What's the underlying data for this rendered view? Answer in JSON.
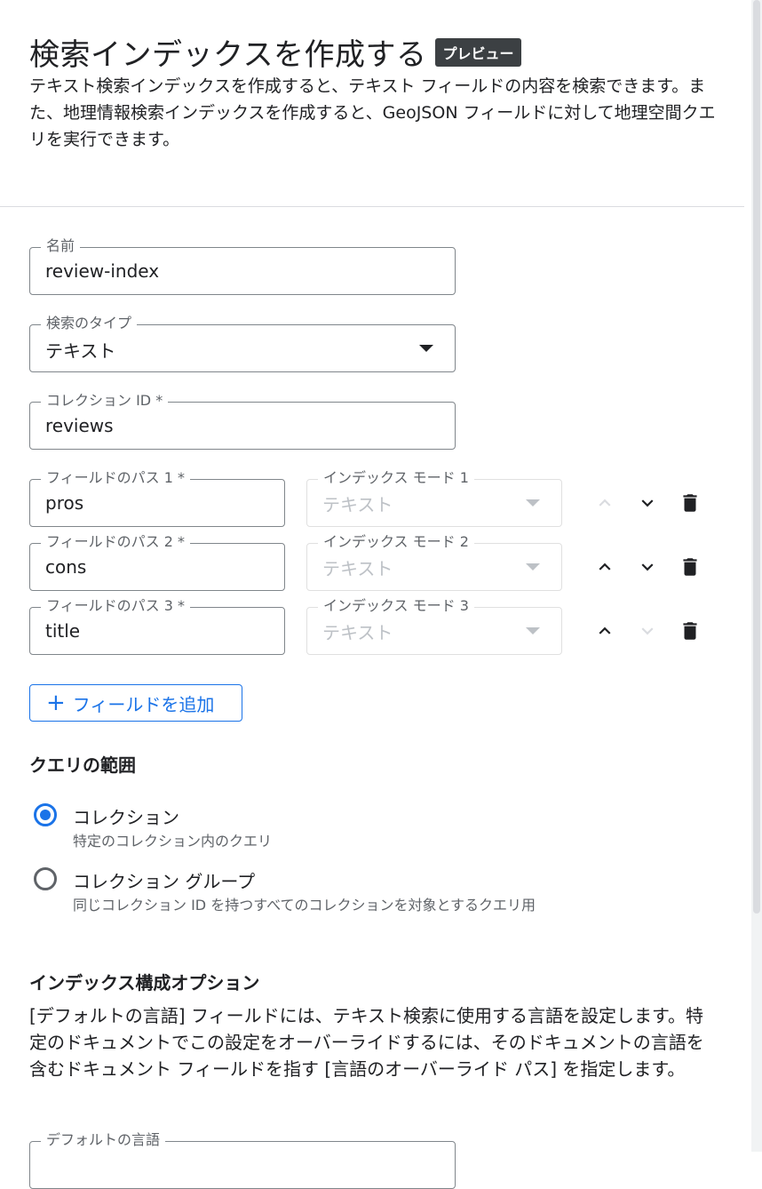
{
  "header": {
    "title": "検索インデックスを作成する",
    "badge": "プレビュー",
    "description": "テキスト検索インデックスを作成すると、テキスト フィールドの内容を検索できます。また、地理情報検索インデックスを作成すると、GeoJSON フィールドに対して地理空間クエリを実行できます。"
  },
  "form": {
    "name": {
      "label": "名前",
      "value": "review-index"
    },
    "search_type": {
      "label": "検索のタイプ",
      "value": "テキスト"
    },
    "collection_id": {
      "label": "コレクション ID *",
      "value": "reviews"
    },
    "fields": [
      {
        "path_label": "フィールドのパス 1 *",
        "path_value": "pros",
        "mode_label": "インデックス モード 1",
        "mode_value": "テキスト"
      },
      {
        "path_label": "フィールドのパス 2 *",
        "path_value": "cons",
        "mode_label": "インデックス モード 2",
        "mode_value": "テキスト"
      },
      {
        "path_label": "フィールドのパス 3 *",
        "path_value": "title",
        "mode_label": "インデックス モード 3",
        "mode_value": "テキスト"
      }
    ],
    "add_field_label": "フィールドを追加"
  },
  "query_scope": {
    "title": "クエリの範囲",
    "options": [
      {
        "label": "コレクション",
        "sub": "特定のコレクション内のクエリ",
        "selected": true
      },
      {
        "label": "コレクション グループ",
        "sub": "同じコレクション ID を持つすべてのコレクションを対象とするクエリ用",
        "selected": false
      }
    ]
  },
  "index_options": {
    "title": "インデックス構成オプション",
    "description": "[デフォルトの言語] フィールドには、テキスト検索に使用する言語を設定します。特定のドキュメントでこの設定をオーバーライドするには、そのドキュメントの言語を含むドキュメント フィールドを指す [言語のオーバーライド パス] を指定します。",
    "default_language_label": "デフォルトの言語"
  },
  "colors": {
    "accent": "#1a73e8",
    "badge_bg": "#3c4043",
    "disabled_icon": "#dadce0"
  }
}
